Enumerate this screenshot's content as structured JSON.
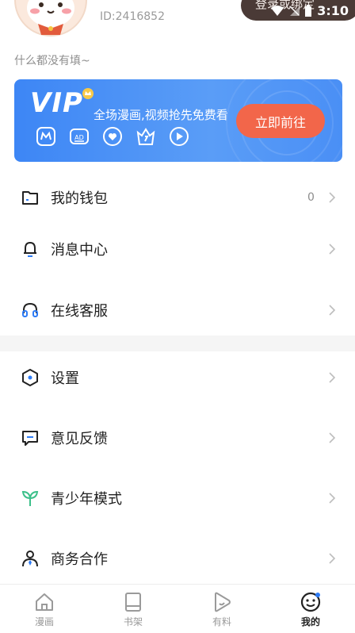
{
  "status_bar": {
    "time": "3:10"
  },
  "profile": {
    "user_id": "ID:2416852",
    "login_label": "登录或绑定",
    "bio": "什么都没有填~"
  },
  "vip": {
    "logo": "VIP",
    "description": "全场漫画,视频抢先免费看",
    "button": "立即前往",
    "perk_icons": [
      "comic-icon",
      "ad-free-icon",
      "heart-icon",
      "crown-icon",
      "play-icon"
    ]
  },
  "menu": [
    {
      "label": "我的钱包",
      "icon": "wallet-icon",
      "count": "0"
    },
    {
      "label": "消息中心",
      "icon": "bell-icon"
    },
    {
      "label": "在线客服",
      "icon": "headset-icon"
    },
    {
      "label": "设置",
      "icon": "settings-hexagon-icon"
    },
    {
      "label": "意见反馈",
      "icon": "feedback-icon"
    },
    {
      "label": "青少年模式",
      "icon": "sprout-icon"
    },
    {
      "label": "商务合作",
      "icon": "business-person-icon"
    }
  ],
  "tabs": [
    {
      "label": "漫画",
      "icon": "home-icon"
    },
    {
      "label": "书架",
      "icon": "bookshelf-icon"
    },
    {
      "label": "有料",
      "icon": "play-bubble-icon"
    },
    {
      "label": "我的",
      "icon": "smile-face-icon",
      "active": true
    }
  ],
  "colors": {
    "vip_gradient_start": "#3d86f5",
    "vip_button": "#f2664a",
    "login_pill": "#4a3a36",
    "sprout_green": "#3cc08a",
    "headset_blue": "#2e7cf6"
  }
}
